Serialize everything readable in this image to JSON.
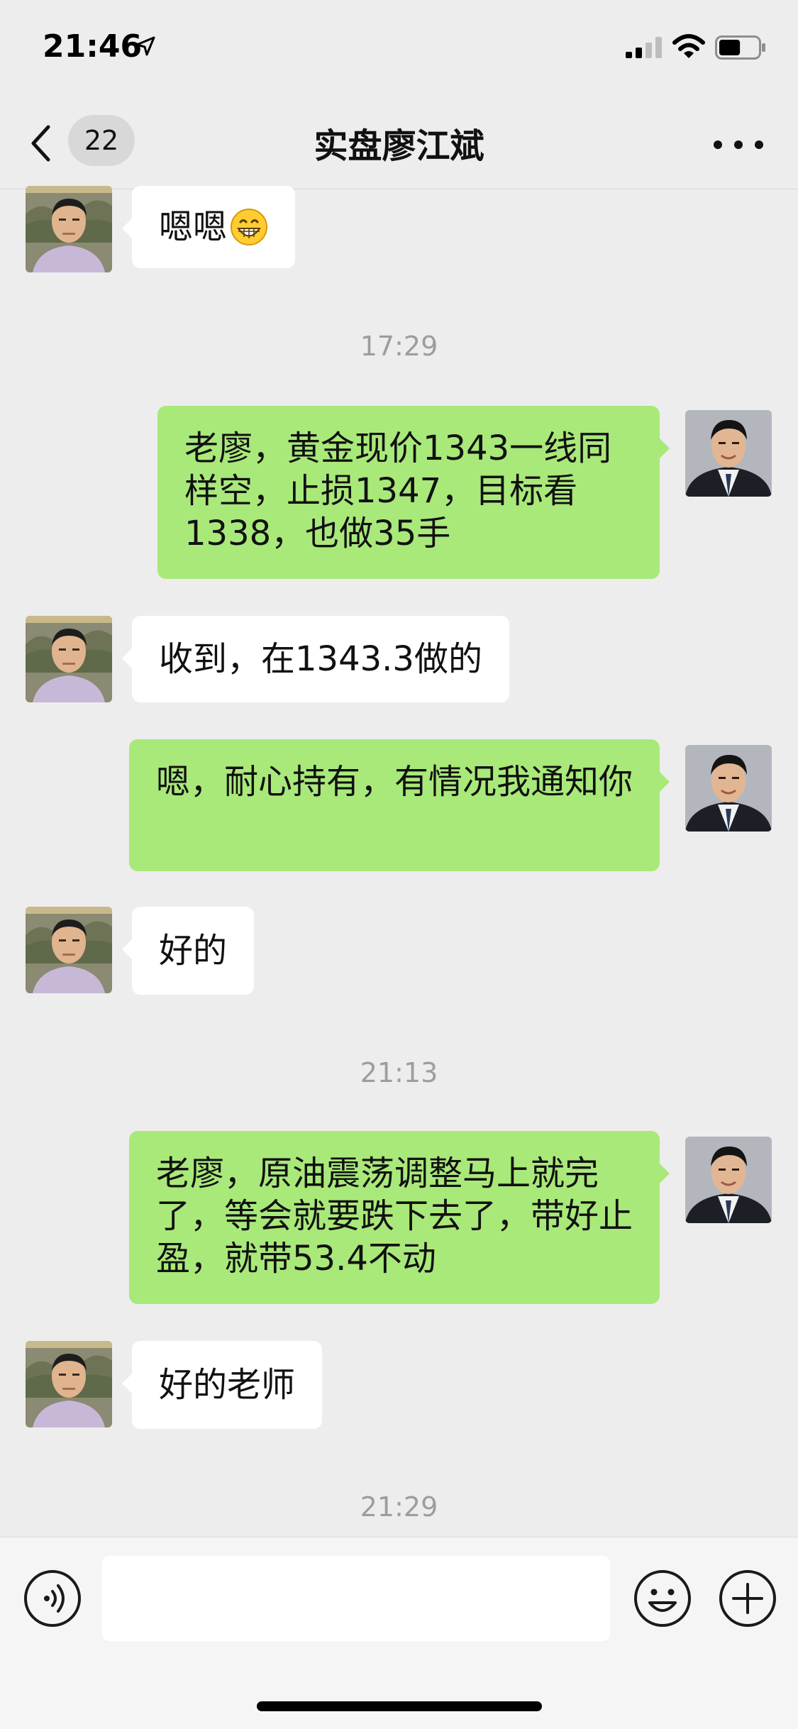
{
  "status_bar": {
    "time": "21:46",
    "battery_level": 0.55
  },
  "nav": {
    "unread_count": "22",
    "title": "实盘廖江斌"
  },
  "messages": [
    {
      "side": "recv",
      "text": "嗯嗯",
      "emoji": "grinning-face"
    },
    {
      "side": "time",
      "text": "17:29"
    },
    {
      "side": "sent",
      "text": "老廖，黄金现价1343一线同样空，止损1347，目标看1338，也做35手"
    },
    {
      "side": "recv",
      "text": "收到，在1343.3做的"
    },
    {
      "side": "sent",
      "text": "嗯，耐心持有，有情况我通知你"
    },
    {
      "side": "recv",
      "text": "好的"
    },
    {
      "side": "time",
      "text": "21:13"
    },
    {
      "side": "sent",
      "text": "老廖，原油震荡调整马上就完了，等会就要跌下去了，带好止盈，就带53.4不动"
    },
    {
      "side": "recv",
      "text": "好的老师"
    },
    {
      "side": "time",
      "text": "21:29"
    }
  ],
  "input_bar": {
    "value": "",
    "placeholder": ""
  },
  "colors": {
    "sent_bubble": "#a9e97a",
    "recv_bubble": "#ffffff",
    "background": "#ededed",
    "timestamp": "#9d9d9d"
  }
}
